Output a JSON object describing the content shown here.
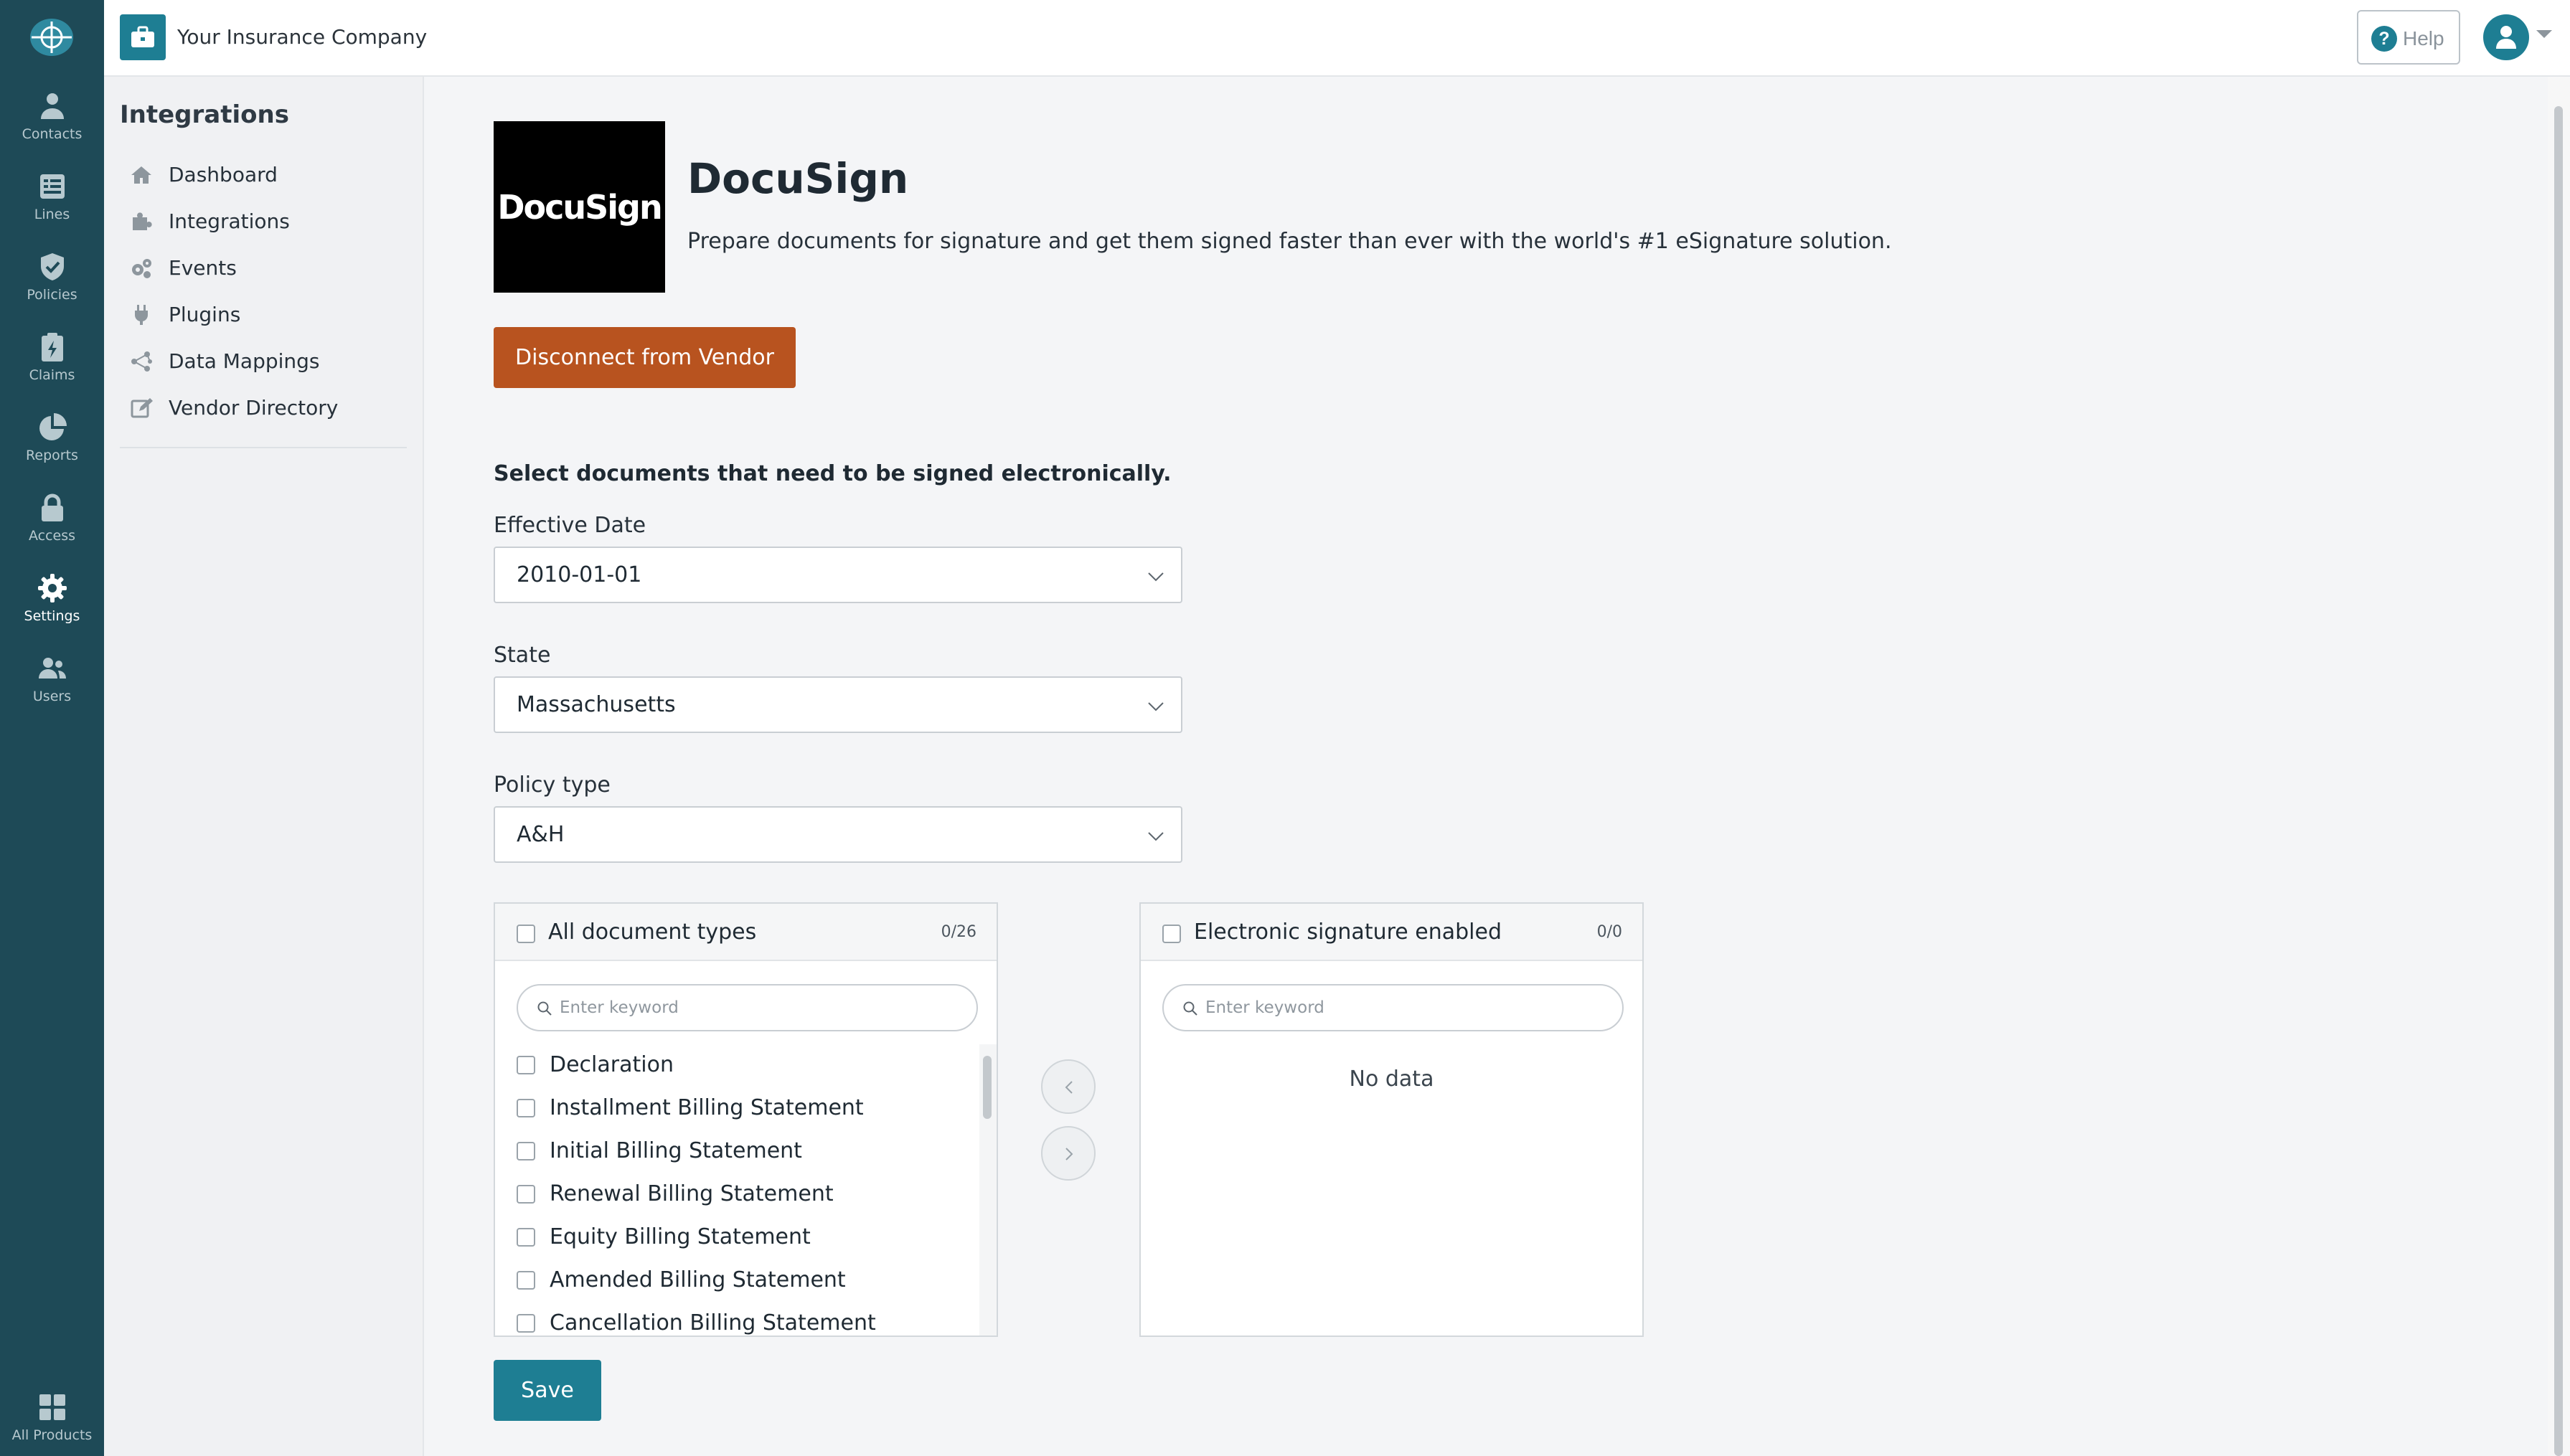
{
  "app": {
    "company_name": "Your Insurance Company",
    "help_label": "Help",
    "accent_color": "#1e7e93",
    "rail_color": "#1e4a57"
  },
  "rail": {
    "items": [
      {
        "label": "Contacts",
        "icon": "person-icon"
      },
      {
        "label": "Lines",
        "icon": "list-icon"
      },
      {
        "label": "Policies",
        "icon": "shield-check-icon"
      },
      {
        "label": "Claims",
        "icon": "clipboard-bolt-icon"
      },
      {
        "label": "Reports",
        "icon": "pie-chart-icon"
      },
      {
        "label": "Access",
        "icon": "lock-icon"
      },
      {
        "label": "Settings",
        "icon": "gear-icon",
        "active": true
      },
      {
        "label": "Users",
        "icon": "users-icon"
      }
    ],
    "all_products_label": "All Products"
  },
  "sidebar": {
    "title": "Integrations",
    "items": [
      {
        "label": "Dashboard",
        "icon": "home-icon"
      },
      {
        "label": "Integrations",
        "icon": "puzzle-icon"
      },
      {
        "label": "Events",
        "icon": "gears-icon"
      },
      {
        "label": "Plugins",
        "icon": "plug-icon"
      },
      {
        "label": "Data Mappings",
        "icon": "network-icon"
      },
      {
        "label": "Vendor Directory",
        "icon": "edit-icon"
      }
    ]
  },
  "vendor": {
    "logo_text": "DocuSign",
    "name": "DocuSign",
    "description": "Prepare documents for signature and get them signed faster than ever with the world's #1 eSignature solution.",
    "disconnect_label": "Disconnect from Vendor",
    "disconnect_color": "#b8531f"
  },
  "form": {
    "instruction": "Select documents that need to be signed electronically.",
    "effective_date": {
      "label": "Effective Date",
      "value": "2010-01-01"
    },
    "state": {
      "label": "State",
      "value": "Massachusetts"
    },
    "policy_type": {
      "label": "Policy type",
      "value": "A&H"
    }
  },
  "transfer": {
    "source": {
      "title": "All document types",
      "count": "0/26",
      "search_placeholder": "Enter keyword",
      "items": [
        "Declaration",
        "Installment Billing Statement",
        "Initial Billing Statement",
        "Renewal Billing Statement",
        "Equity Billing Statement",
        "Amended Billing Statement",
        "Cancellation Billing Statement"
      ]
    },
    "target": {
      "title": "Electronic signature enabled",
      "count": "0/0",
      "search_placeholder": "Enter keyword",
      "empty_text": "No data"
    }
  },
  "save_label": "Save"
}
